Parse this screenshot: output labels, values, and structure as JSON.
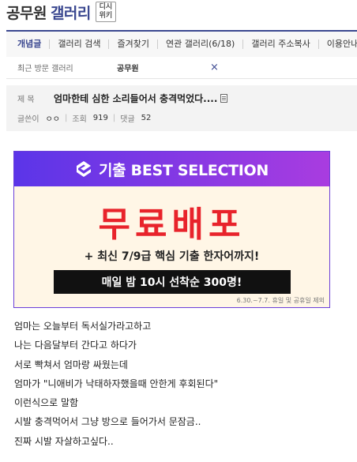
{
  "header": {
    "gallery_name": "공무원",
    "gallery_word": "갤러리",
    "badge_line1": "디시",
    "badge_line2": "위키"
  },
  "nav": {
    "items": [
      {
        "label": "개념글",
        "active": true
      },
      {
        "label": "갤러리 검색"
      },
      {
        "label": "즐겨찾기"
      },
      {
        "label": "연관 갤러리(6/18)"
      },
      {
        "label": "갤러리 주소복사"
      },
      {
        "label": "이용안내"
      }
    ]
  },
  "recent": {
    "label": "최근 방문 갤러리",
    "gallery": "공무원",
    "close": "×"
  },
  "post": {
    "title_label": "제 목",
    "title": "엄마한테 심한 소리들어서 충격먹었다....",
    "author_label": "글쓴이",
    "author": "ㅇㅇ",
    "views_label": "조회",
    "views": "919",
    "comments_label": "댓글",
    "comments": "52"
  },
  "ad": {
    "top_text": "기출 BEST SELECTION",
    "big_text": "무료배포",
    "sub_text": "+ 최신 7/9급 핵심 기출 한자어까지!",
    "bar_text": "매일 밤 10시 선착순 300명!",
    "note": "6.30.~7.7. 휴일 및 공휴일 제외",
    "colors": {
      "gradient_start": "#5b35e8",
      "gradient_end": "#a93ce0",
      "headline": "#e8232b"
    }
  },
  "body_lines": [
    "엄마는 오늘부터 독서실가라고하고",
    "나는 다음달부터 간다고 하다가",
    "서로 빡쳐서 엄마랑 싸웠는데",
    "엄마가 \"니애비가 낙태하자했을때 안한게 후회된다\"",
    "이런식으로 말함",
    "시발 충격먹어서 그냥 방으로 들어가서 문잠금..",
    "진짜 시발 자살하고싶다.."
  ],
  "colors": {
    "accent": "#3b4890"
  }
}
